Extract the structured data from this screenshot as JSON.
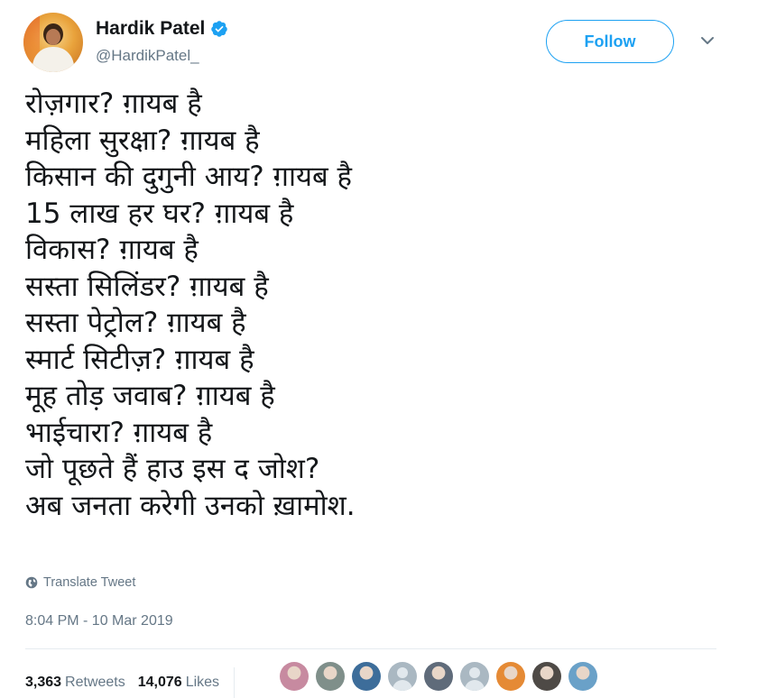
{
  "author": {
    "name": "Hardik Patel",
    "handle": "@HardikPatel_",
    "verified": true,
    "avatar_icon": "profile-photo"
  },
  "follow_label": "Follow",
  "tweet_lines": [
    "रोज़गार? ग़ायब है",
    "महिला सुरक्षा? ग़ायब है",
    "किसान की दुगुनी आय? ग़ायब है",
    "15 लाख हर घर? ग़ायब है",
    "विकास? ग़ायब है",
    "सस्ता सिलिंडर? ग़ायब है",
    "सस्ता पेट्रोल? ग़ायब है",
    "स्मार्ट सिटीज़? ग़ायब है",
    "मूह तोड़ जवाब? ग़ायब है",
    "भाईचारा? ग़ायब है",
    "जो पूछते हैं हाउ इस द जोश?",
    "अब जनता करेगी उनको ख़ामोश."
  ],
  "translate_label": "Translate Tweet",
  "timestamp": "8:04 PM - 10 Mar 2019",
  "stats": {
    "retweets_count": "3,363",
    "retweets_label": "Retweets",
    "likes_count": "14,076",
    "likes_label": "Likes"
  },
  "liker_avatars": [
    {
      "icon": "user-avatar",
      "color": "#c78aa0"
    },
    {
      "icon": "user-avatar",
      "color": "#7f8f8a"
    },
    {
      "icon": "user-avatar",
      "color": "#3d6d9a"
    },
    {
      "icon": "default-avatar",
      "color": "#aab8c2"
    },
    {
      "icon": "user-avatar",
      "color": "#5f6b7a"
    },
    {
      "icon": "default-avatar",
      "color": "#aab8c2"
    },
    {
      "icon": "user-avatar",
      "color": "#e58a35"
    },
    {
      "icon": "user-avatar",
      "color": "#4e4a46"
    },
    {
      "icon": "user-avatar",
      "color": "#6aa1c8"
    }
  ],
  "colors": {
    "accent": "#1da1f2",
    "text_primary": "#14171a",
    "text_secondary": "#657786"
  }
}
